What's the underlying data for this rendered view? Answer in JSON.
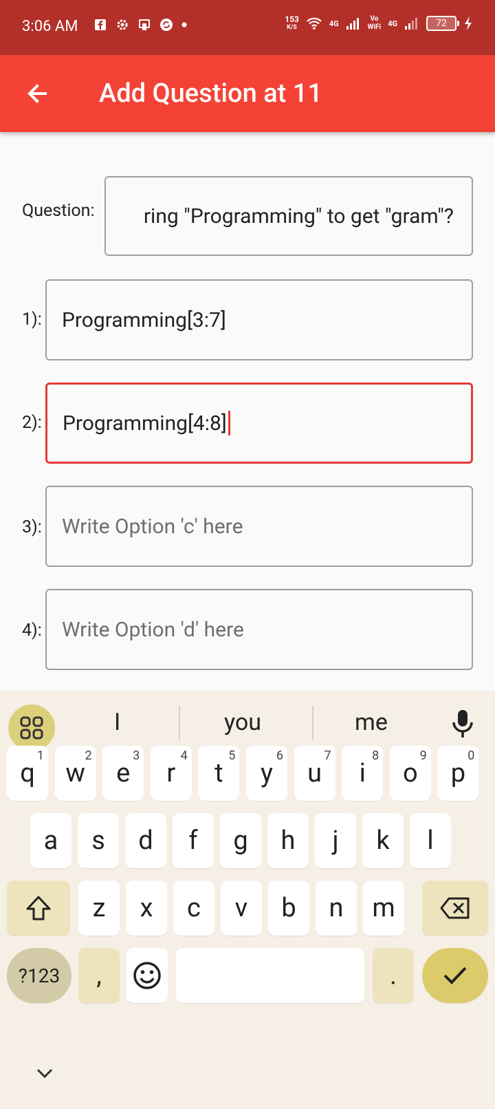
{
  "status_bar": {
    "time": "3:06 AM",
    "speed_value": "153",
    "speed_unit": "K/S",
    "network1": "4G",
    "vowifi_top": "Vo",
    "vowifi_bottom": "WiFi",
    "network2": "4G",
    "battery": "72"
  },
  "app_bar": {
    "title": "Add Question at 11"
  },
  "form": {
    "question_label": "Question:",
    "question_value": "ring \"Programming\" to get \"gram\"?",
    "options": [
      {
        "label": "1):",
        "value": "Programming[3:7]",
        "placeholder": ""
      },
      {
        "label": "2):",
        "value": "Programming[4:8]",
        "placeholder": ""
      },
      {
        "label": "3):",
        "value": "",
        "placeholder": "Write Option 'c' here"
      },
      {
        "label": "4):",
        "value": "",
        "placeholder": "Write Option 'd' here"
      }
    ]
  },
  "keyboard": {
    "suggestions": [
      "I",
      "you",
      "me"
    ],
    "row1": [
      {
        "key": "q",
        "hint": "1"
      },
      {
        "key": "w",
        "hint": "2"
      },
      {
        "key": "e",
        "hint": "3"
      },
      {
        "key": "r",
        "hint": "4"
      },
      {
        "key": "t",
        "hint": "5"
      },
      {
        "key": "y",
        "hint": "6"
      },
      {
        "key": "u",
        "hint": "7"
      },
      {
        "key": "i",
        "hint": "8"
      },
      {
        "key": "o",
        "hint": "9"
      },
      {
        "key": "p",
        "hint": "0"
      }
    ],
    "row2": [
      "a",
      "s",
      "d",
      "f",
      "g",
      "h",
      "j",
      "k",
      "l"
    ],
    "row3": [
      "z",
      "x",
      "c",
      "v",
      "b",
      "n",
      "m"
    ],
    "symbols_label": "?123",
    "comma": ",",
    "period": "."
  },
  "colors": {
    "status_bar": "#b3302a",
    "app_bar": "#f44336",
    "focus_border": "#e53935",
    "keyboard_bg": "#f6efe6",
    "accent_key": "#dccb6a"
  }
}
